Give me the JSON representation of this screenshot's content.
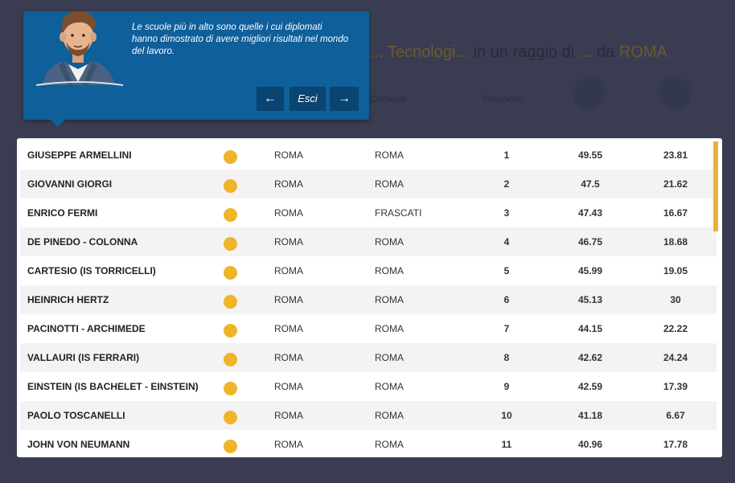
{
  "background": {
    "heading_parts": [
      "... Tecnologi...",
      " in un raggio di ",
      "...",
      " da ",
      "ROMA"
    ],
    "columns": [
      "Comune",
      "Posizione"
    ]
  },
  "tooltip": {
    "text": "Le scuole più in alto sono quelle i cui diplomati hanno dimostrato di avere migliori risultati nel mondo del lavoro.",
    "prev_label": "←",
    "exit_label": "Esci",
    "next_label": "→"
  },
  "table": {
    "rows": [
      {
        "name": "GIUSEPPE ARMELLINI",
        "city": "ROMA",
        "comune": "ROMA",
        "pos": "1",
        "v1": "49.55",
        "v2": "23.81"
      },
      {
        "name": "GIOVANNI GIORGI",
        "city": "ROMA",
        "comune": "ROMA",
        "pos": "2",
        "v1": "47.5",
        "v2": "21.62"
      },
      {
        "name": "ENRICO FERMI",
        "city": "ROMA",
        "comune": "FRASCATI",
        "pos": "3",
        "v1": "47.43",
        "v2": "16.67"
      },
      {
        "name": "DE PINEDO - COLONNA",
        "city": "ROMA",
        "comune": "ROMA",
        "pos": "4",
        "v1": "46.75",
        "v2": "18.68"
      },
      {
        "name": "CARTESIO (IS TORRICELLI)",
        "city": "ROMA",
        "comune": "ROMA",
        "pos": "5",
        "v1": "45.99",
        "v2": "19.05"
      },
      {
        "name": "HEINRICH HERTZ",
        "city": "ROMA",
        "comune": "ROMA",
        "pos": "6",
        "v1": "45.13",
        "v2": "30"
      },
      {
        "name": "PACINOTTI - ARCHIMEDE",
        "city": "ROMA",
        "comune": "ROMA",
        "pos": "7",
        "v1": "44.15",
        "v2": "22.22"
      },
      {
        "name": "VALLAURI (IS FERRARI)",
        "city": "ROMA",
        "comune": "ROMA",
        "pos": "8",
        "v1": "42.62",
        "v2": "24.24"
      },
      {
        "name": "EINSTEIN (IS BACHELET - EINSTEIN)",
        "city": "ROMA",
        "comune": "ROMA",
        "pos": "9",
        "v1": "42.59",
        "v2": "17.39"
      },
      {
        "name": "PAOLO TOSCANELLI",
        "city": "ROMA",
        "comune": "ROMA",
        "pos": "10",
        "v1": "41.18",
        "v2": "6.67"
      },
      {
        "name": "JOHN VON NEUMANN",
        "city": "ROMA",
        "comune": "ROMA",
        "pos": "11",
        "v1": "40.96",
        "v2": "17.78"
      }
    ],
    "indicator_color": "#f0b429"
  },
  "colors": {
    "tooltip_bg": "#0f5f9a",
    "button_bg": "#0a4470",
    "page_bg": "#3a3d52",
    "scrollbar": "#e8b23a"
  },
  "icons": {
    "avatar": "man-avatar-icon",
    "indicator": "status-dot-icon"
  }
}
